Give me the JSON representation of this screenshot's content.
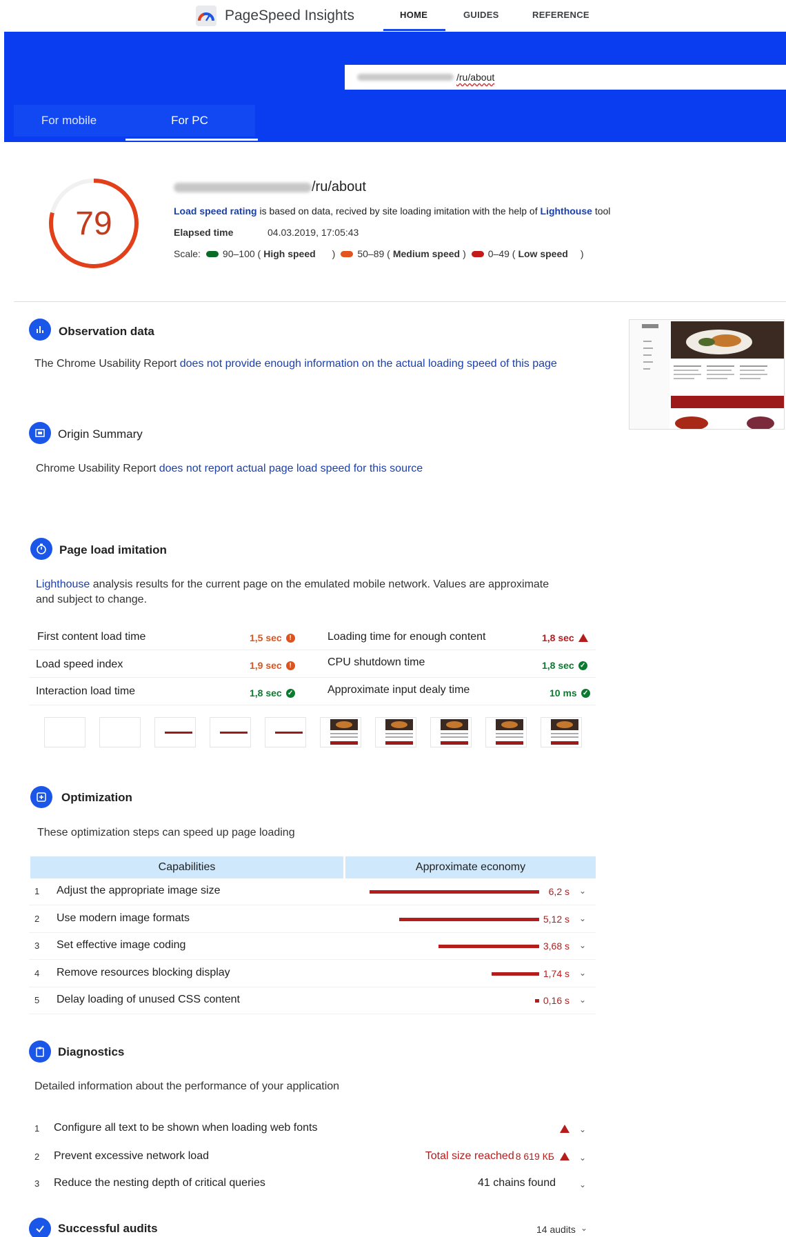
{
  "nav": {
    "brand": "PageSpeed Insights",
    "tabs": [
      "HOME",
      "GUIDES",
      "REFERENCE"
    ]
  },
  "url_bar": {
    "value": "/ru/about"
  },
  "device_tabs": {
    "mobile": "For mobile",
    "pc": "For PC"
  },
  "score": {
    "value": 79,
    "page_url": "/ru/about",
    "rating_link": "Load speed rating",
    "rating_text": " is based on data, recived by site loading imitation with the help of ",
    "lighthouse": "Lighthouse",
    "tool": " tool",
    "elapsed_label": "Elapsed time",
    "elapsed_value": "04.03.2019, 17:05:43",
    "scale_label": "Scale:",
    "scale": [
      {
        "range": "90–100 (",
        "label": "High speed",
        "close": ")",
        "color": "#0a6b25"
      },
      {
        "range": "50–89 (",
        "label": "Medium speed",
        "close": ")",
        "color": "#e2531d"
      },
      {
        "range": "0–49 (",
        "label": "Low speed",
        "close": ")",
        "color": "#c41a1a"
      }
    ]
  },
  "observation": {
    "title": "Observation data",
    "text": "The Chrome Usability Report ",
    "link": "does not provide enough information on the actual loading speed of this page"
  },
  "origin": {
    "title": "Origin Summary",
    "text": "Chrome Usability Report ",
    "link": "does not report actual page load speed for this source"
  },
  "simulation": {
    "title": "Page load imitation",
    "lighthouse": "Lighthouse",
    "text_line1": " analysis results for the current page on the emulated mobile network. Values are approximate",
    "text_line2": "and subject to change.",
    "metrics": [
      {
        "label": "First content load time",
        "value": "1,5 sec",
        "status": "orange"
      },
      {
        "label": "Loading time for enough content",
        "value": "1,8 sec",
        "status": "red"
      },
      {
        "label": "Load speed index",
        "value": "1,9 sec",
        "status": "orange"
      },
      {
        "label": "CPU shutdown time",
        "value": "1,8 sec",
        "status": "green"
      },
      {
        "label": "Interaction load time",
        "value": "1,8 sec",
        "status": "green"
      },
      {
        "label": "Approximate input dealy time",
        "value": "10 ms",
        "status": "green"
      }
    ]
  },
  "optimization": {
    "title": "Optimization",
    "subtitle": "These optimization steps can speed up page loading",
    "col_capabilities": "Capabilities",
    "col_economy": "Approximate economy",
    "rows": [
      {
        "n": "1",
        "label": "Adjust the appropriate image size",
        "value": "6,2 s",
        "seconds": 6.2
      },
      {
        "n": "2",
        "label": "Use modern image formats",
        "value": "5,12 s",
        "seconds": 5.12
      },
      {
        "n": "3",
        "label": "Set effective image coding",
        "value": "3,68 s",
        "seconds": 3.68
      },
      {
        "n": "4",
        "label": "Remove resources blocking display",
        "value": "1,74 s",
        "seconds": 1.74
      },
      {
        "n": "5",
        "label": "Delay loading of unused  CSS content",
        "value": "0,16 s",
        "seconds": 0.16
      }
    ]
  },
  "diagnostics": {
    "title": "Diagnostics",
    "subtitle": "Detailed information about the performance of your application",
    "rows": [
      {
        "n": "1",
        "label": "Configure all text to be shown when loading web fonts",
        "right": ""
      },
      {
        "n": "2",
        "label": "Prevent excessive network load",
        "right_prefix": "Total size reached ",
        "right": "8 619 КБ"
      },
      {
        "n": "3",
        "label": "Reduce the nesting depth of critical queries",
        "right": "41 chains found"
      }
    ]
  },
  "audits": {
    "title": "Successful audits",
    "count": "14 audits"
  },
  "colors": {
    "accent": "#0b3df0",
    "score": "#e2401b",
    "danger": "#b51c1c",
    "good": "#0a7a30"
  }
}
